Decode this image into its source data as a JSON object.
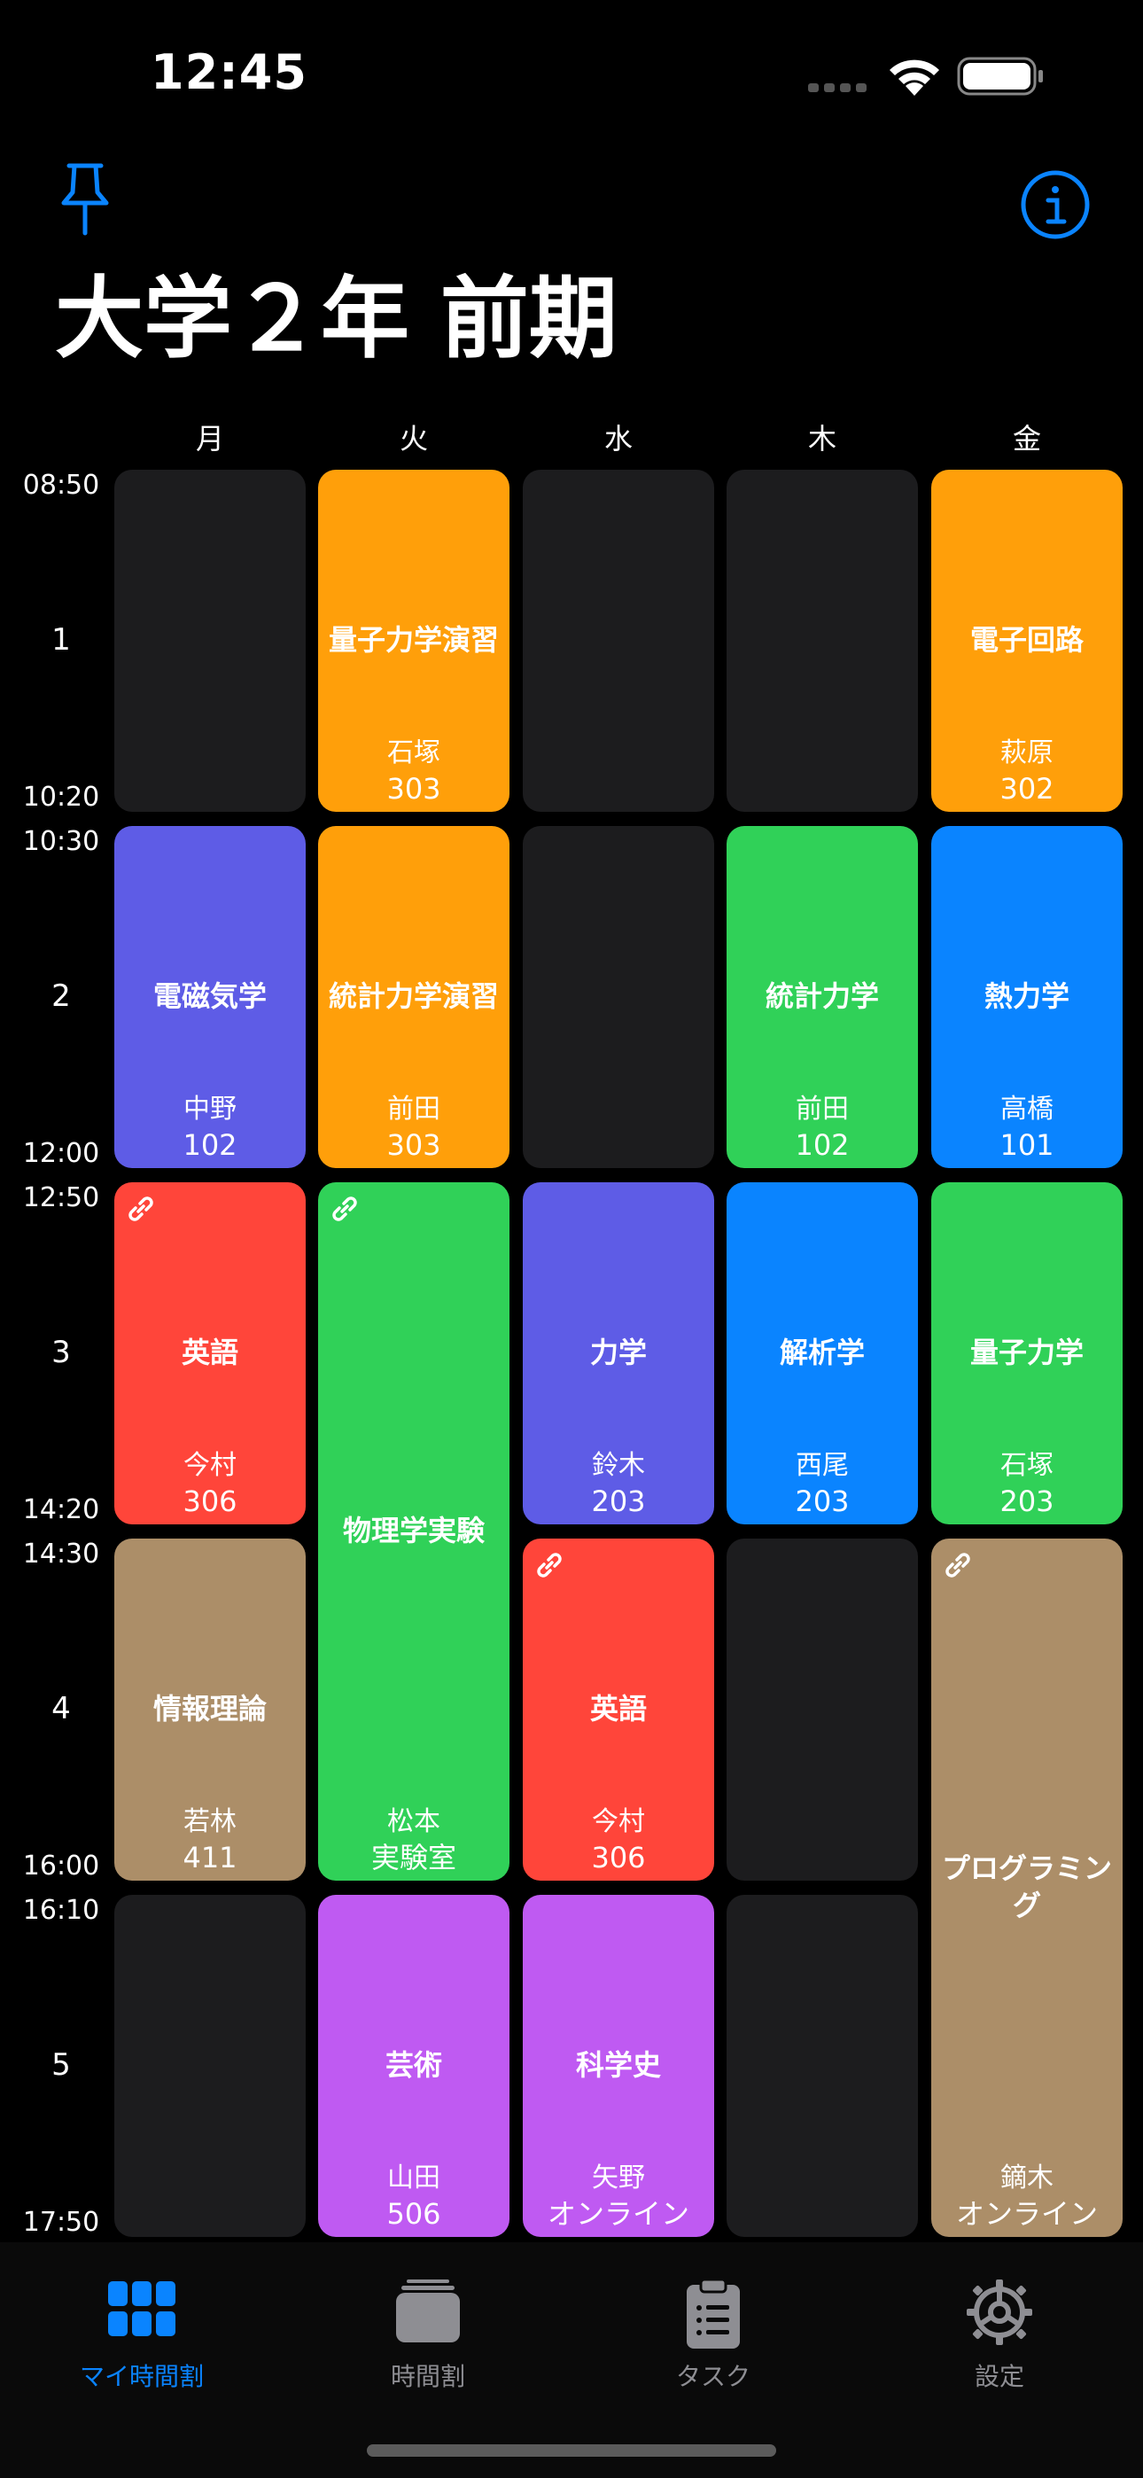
{
  "status_bar": {
    "time": "12:45"
  },
  "header": {
    "title": "大学２年 前期"
  },
  "days": [
    "月",
    "火",
    "水",
    "木",
    "金"
  ],
  "periods": [
    {
      "number": "1",
      "start": "08:50",
      "end": "10:20"
    },
    {
      "number": "2",
      "start": "10:30",
      "end": "12:00"
    },
    {
      "number": "3",
      "start": "12:50",
      "end": "14:20"
    },
    {
      "number": "4",
      "start": "14:30",
      "end": "16:00"
    },
    {
      "number": "5",
      "start": "16:10",
      "end": "17:50"
    }
  ],
  "colors": {
    "orange": "#FF9F0A",
    "indigo": "#5E5CE6",
    "green": "#30D158",
    "blue": "#0A84FF",
    "red": "#FF453A",
    "brown": "#AC8E68",
    "purple": "#BF5AF2",
    "empty": "#1C1C1E",
    "accent": "#0A84FF"
  },
  "courses": {
    "tue_1": {
      "name": "量子力学演習",
      "teacher": "石塚",
      "room": "303"
    },
    "fri_1": {
      "name": "電子回路",
      "teacher": "萩原",
      "room": "302"
    },
    "mon_2": {
      "name": "電磁気学",
      "teacher": "中野",
      "room": "102"
    },
    "tue_2": {
      "name": "統計力学演習",
      "teacher": "前田",
      "room": "303"
    },
    "thu_2": {
      "name": "統計力学",
      "teacher": "前田",
      "room": "102"
    },
    "fri_2": {
      "name": "熱力学",
      "teacher": "高橋",
      "room": "101"
    },
    "mon_3": {
      "name": "英語",
      "teacher": "今村",
      "room": "306"
    },
    "tue_3": {
      "name": "物理学実験",
      "teacher": "松本",
      "room": "実験室"
    },
    "wed_3": {
      "name": "力学",
      "teacher": "鈴木",
      "room": "203"
    },
    "thu_3": {
      "name": "解析学",
      "teacher": "西尾",
      "room": "203"
    },
    "fri_3": {
      "name": "量子力学",
      "teacher": "石塚",
      "room": "203"
    },
    "mon_4": {
      "name": "情報理論",
      "teacher": "若林",
      "room": "411"
    },
    "wed_4": {
      "name": "英語",
      "teacher": "今村",
      "room": "306"
    },
    "fri_4": {
      "name": "プログラミング",
      "teacher": "鏑木",
      "room": "オンライン"
    },
    "tue_5": {
      "name": "芸術",
      "teacher": "山田",
      "room": "506"
    },
    "wed_5": {
      "name": "科学史",
      "teacher": "矢野",
      "room": "オンライン"
    }
  },
  "tabs": [
    {
      "label": "マイ時間割",
      "icon": "grid-icon",
      "active": true
    },
    {
      "label": "時間割",
      "icon": "stack-icon",
      "active": false
    },
    {
      "label": "タスク",
      "icon": "clipboard-icon",
      "active": false
    },
    {
      "label": "設定",
      "icon": "gear-icon",
      "active": false
    }
  ]
}
